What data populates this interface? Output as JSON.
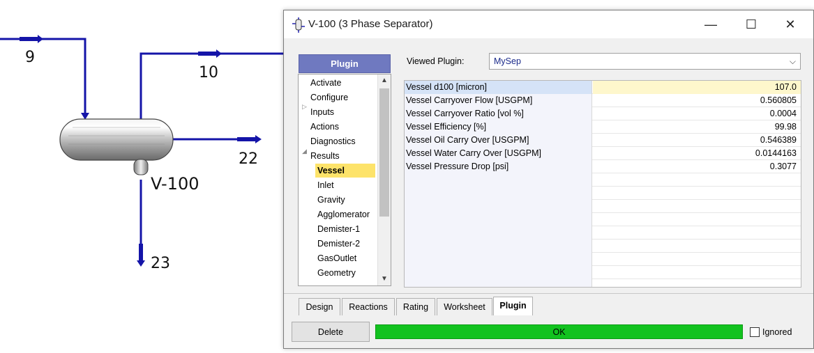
{
  "flowsheet": {
    "streams": [
      "9",
      "10",
      "22",
      "23"
    ],
    "unit_label": "V-100",
    "stream_color": "#1414a8"
  },
  "window": {
    "title": "V-100 (3 Phase Separator)",
    "controls": {
      "minimize": "—",
      "maximize": "☐",
      "close": "✕"
    }
  },
  "nav": {
    "header": "Plugin",
    "items": [
      "Activate",
      "Configure",
      "Inputs",
      "Actions",
      "Diagnostics",
      "Results",
      "Vessel",
      "Inlet",
      "Gravity",
      "Agglomerator",
      "Demister-1",
      "Demister-2",
      "GasOutlet",
      "Geometry"
    ],
    "selected": "Vessel"
  },
  "plugin": {
    "label": "Viewed Plugin:",
    "value": "MySep"
  },
  "grid": {
    "rows": [
      {
        "name": "Vessel d100  [micron]",
        "value": "107.0"
      },
      {
        "name": "Vessel Carryover Flow  [USGPM]",
        "value": "0.560805"
      },
      {
        "name": "Vessel Carryover Ratio [vol %]",
        "value": "0.0004"
      },
      {
        "name": "Vessel Efficiency  [%]",
        "value": "99.98"
      },
      {
        "name": "Vessel Oil Carry Over  [USGPM]",
        "value": "0.546389"
      },
      {
        "name": "Vessel Water Carry Over  [USGPM]",
        "value": "0.0144163"
      },
      {
        "name": "Vessel Pressure Drop  [psi]",
        "value": "0.3077"
      }
    ]
  },
  "tabs": [
    "Design",
    "Reactions",
    "Rating",
    "Worksheet",
    "Plugin"
  ],
  "active_tab": "Plugin",
  "footer": {
    "delete_label": "Delete",
    "status_label": "OK",
    "status_color": "#12c21f",
    "ignored_label": "Ignored"
  }
}
